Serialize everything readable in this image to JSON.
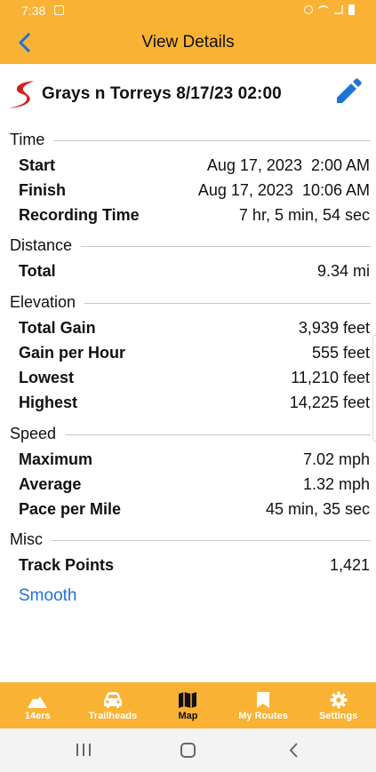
{
  "status_bar": {
    "time": "7:38"
  },
  "app_bar": {
    "title": "View Details"
  },
  "track": {
    "name": "Grays n Torreys 8/17/23 02:00"
  },
  "sections": {
    "time": {
      "title": "Time",
      "rows": [
        {
          "label": "Start",
          "value": "Aug 17, 2023  2:00 AM"
        },
        {
          "label": "Finish",
          "value": "Aug 17, 2023  10:06 AM"
        },
        {
          "label": "Recording Time",
          "value": "7 hr, 5 min, 54 sec"
        }
      ]
    },
    "distance": {
      "title": "Distance",
      "rows": [
        {
          "label": "Total",
          "value": "9.34 mi"
        }
      ]
    },
    "elevation": {
      "title": "Elevation",
      "rows": [
        {
          "label": "Total Gain",
          "value": "3,939 feet"
        },
        {
          "label": "Gain per Hour",
          "value": "555 feet"
        },
        {
          "label": "Lowest",
          "value": "11,210 feet"
        },
        {
          "label": "Highest",
          "value": "14,225 feet"
        }
      ]
    },
    "speed": {
      "title": "Speed",
      "rows": [
        {
          "label": "Maximum",
          "value": "7.02 mph"
        },
        {
          "label": "Average",
          "value": "1.32 mph"
        },
        {
          "label": "Pace per Mile",
          "value": "45 min, 35 sec"
        }
      ]
    },
    "misc": {
      "title": "Misc",
      "rows": [
        {
          "label": "Track Points",
          "value": "1,421"
        }
      ]
    }
  },
  "smooth_link": "Smooth",
  "bottom_nav": {
    "items": [
      {
        "label": "14ers",
        "icon": "mountain-icon"
      },
      {
        "label": "Trailheads",
        "icon": "car-icon"
      },
      {
        "label": "Map",
        "icon": "map-icon",
        "active": true
      },
      {
        "label": "My Routes",
        "icon": "bookmark-icon"
      },
      {
        "label": "Settings",
        "icon": "gear-icon"
      }
    ]
  },
  "colors": {
    "accent": "#f9b233",
    "link": "#1f73d6",
    "logo": "#d62020",
    "edit": "#1f73d6"
  }
}
